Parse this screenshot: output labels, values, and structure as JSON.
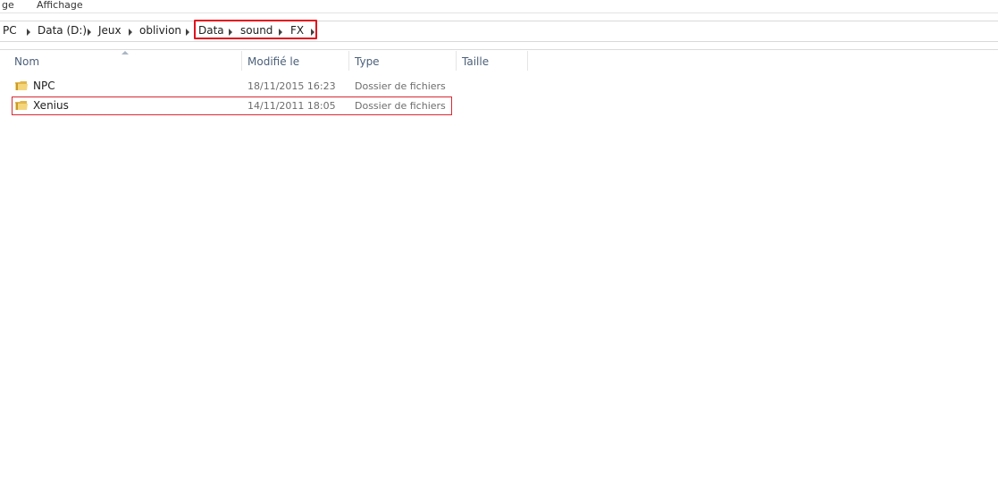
{
  "ribbon": {
    "items": [
      {
        "label": "ge"
      },
      {
        "label": "Affichage"
      }
    ]
  },
  "addressbar": {
    "crumbs": [
      {
        "label": "PC"
      },
      {
        "label": "Data (D:)"
      },
      {
        "label": "Jeux"
      },
      {
        "label": "oblivion"
      },
      {
        "label": "Data"
      },
      {
        "label": "sound"
      },
      {
        "label": "FX"
      }
    ],
    "highlight_color": "#e0121e"
  },
  "columns": {
    "name": "Nom",
    "modified": "Modifié le",
    "type": "Type",
    "size": "Taille"
  },
  "files": [
    {
      "name": "NPC",
      "modified": "18/11/2015 16:23",
      "type": "Dossier de fichiers",
      "icon": "folder-icon"
    },
    {
      "name": "Xenius",
      "modified": "14/11/2011 18:05",
      "type": "Dossier de fichiers",
      "icon": "folder-icon"
    }
  ],
  "colors": {
    "header_text": "#4c607a",
    "secondary_text": "#6d6d6d",
    "annotation_red": "#d62a35"
  }
}
